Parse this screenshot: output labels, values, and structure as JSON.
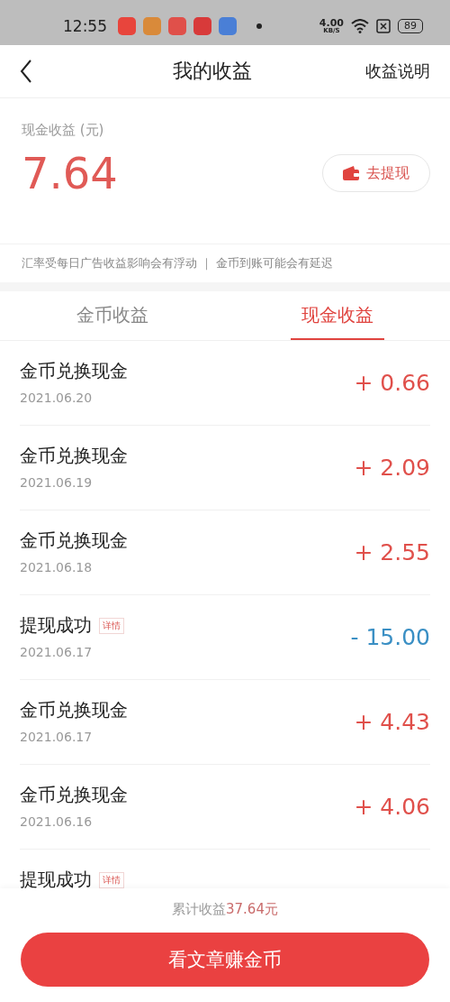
{
  "status_bar": {
    "time": "12:55",
    "app_icons": [
      {
        "color": "#e8453c"
      },
      {
        "color": "#d98a3a"
      },
      {
        "color": "#e0504a"
      },
      {
        "color": "#d83a3a"
      },
      {
        "color": "#4a7fd6"
      }
    ],
    "speed": "4.00",
    "speed_unit": "KB/S",
    "battery": "89"
  },
  "header": {
    "title": "我的收益",
    "action": "收益说明"
  },
  "summary": {
    "label": "现金收益 (元)",
    "amount": "7.64",
    "withdraw_button": "去提现",
    "note": "汇率受每日广告收益影响会有浮动 ｜ 金币到账可能会有延迟"
  },
  "tabs": [
    {
      "label": "金币收益",
      "selected": false
    },
    {
      "label": "现金收益",
      "selected": true
    }
  ],
  "records": [
    {
      "kind": "income",
      "title": "金币兑换现金",
      "date": "2021.06.20",
      "amount": "+ 0.66"
    },
    {
      "kind": "income",
      "title": "金币兑换现金",
      "date": "2021.06.19",
      "amount": "+ 2.09"
    },
    {
      "kind": "income",
      "title": "金币兑换现金",
      "date": "2021.06.18",
      "amount": "+ 2.55"
    },
    {
      "kind": "withdrawal",
      "title": "提现成功",
      "badge": "详情",
      "date": "2021.06.17",
      "amount": "- 15.00"
    },
    {
      "kind": "income",
      "title": "金币兑换现金",
      "date": "2021.06.17",
      "amount": "+ 4.43"
    },
    {
      "kind": "income",
      "title": "金币兑换现金",
      "date": "2021.06.16",
      "amount": "+ 4.06"
    },
    {
      "title": "提现成功",
      "badge": "详情"
    }
  ],
  "footer": {
    "total_label": "累计收益",
    "total_value": "37.64元",
    "button": "看文章赚金币"
  }
}
